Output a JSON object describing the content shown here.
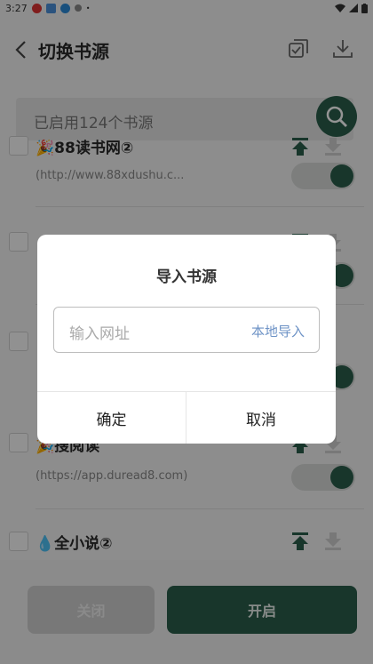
{
  "status_bar": {
    "time": "3:27"
  },
  "header": {
    "title": "切换书源",
    "icons": [
      "back-icon",
      "select-all-icon",
      "download-icon"
    ]
  },
  "search": {
    "placeholder": "已启用124个书源",
    "icon": "search-icon"
  },
  "sources": [
    {
      "name": "🎉88读书网②",
      "url": "(http://www.88xdushu.c..."
    },
    {
      "name": "",
      "url": ""
    },
    {
      "name": "",
      "url": ""
    },
    {
      "name": "🎉搜阅读",
      "url": "(https://app.duread8.com)"
    },
    {
      "name": "💧全小说②",
      "url": ""
    }
  ],
  "bottom_buttons": {
    "close": "关闭",
    "open": "开启"
  },
  "dialog": {
    "title": "导入书源",
    "input_placeholder": "输入网址",
    "local_import": "本地导入",
    "confirm": "确定",
    "cancel": "取消"
  },
  "colors": {
    "accent": "#2a5e4a",
    "link": "#6e93c6"
  }
}
